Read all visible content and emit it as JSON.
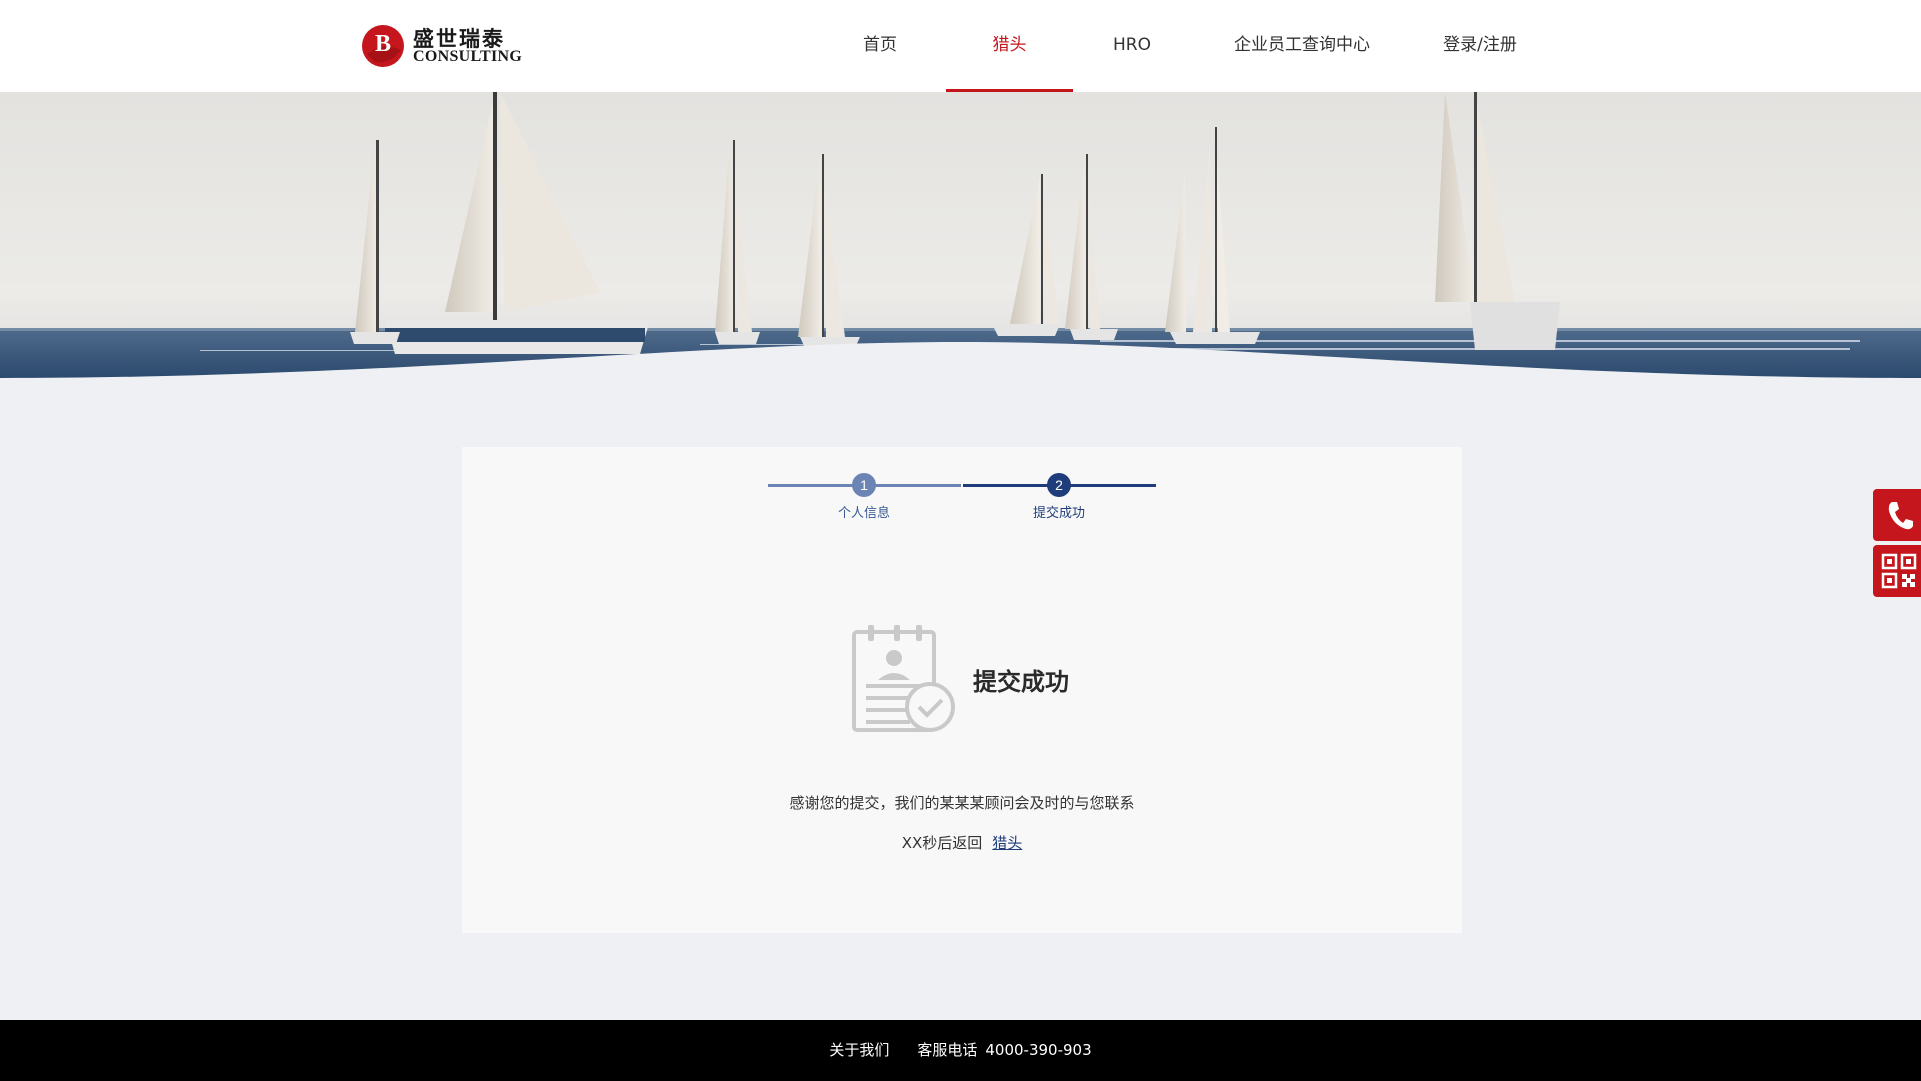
{
  "logo": {
    "name_cn": "盛世瑞泰",
    "name_en": "CONSULTING",
    "mark_letter": "B"
  },
  "nav": {
    "items": [
      {
        "label": "首页",
        "active": false
      },
      {
        "label": "猎头",
        "active": true
      },
      {
        "label": "HRO",
        "active": false
      },
      {
        "label": "企业员工查询中心",
        "active": false
      },
      {
        "label": "登录/注册",
        "active": false
      }
    ]
  },
  "steps": [
    {
      "number": "1",
      "label": "个人信息"
    },
    {
      "number": "2",
      "label": "提交成功"
    }
  ],
  "result": {
    "title": "提交成功",
    "message": "感谢您的提交，我们的某某某顾问会及时的与您联系",
    "countdown_text": "XX秒后返回",
    "back_link": "猎头"
  },
  "side": {
    "phone_icon": "phone-icon",
    "qr_icon": "qrcode-icon"
  },
  "footer": {
    "about": "关于我们",
    "hotline_label": "客服电话",
    "hotline": "4000-390-903"
  },
  "colors": {
    "accent": "#c4161c",
    "navy": "#1f3d7a",
    "step_light": "#6b84b3"
  }
}
